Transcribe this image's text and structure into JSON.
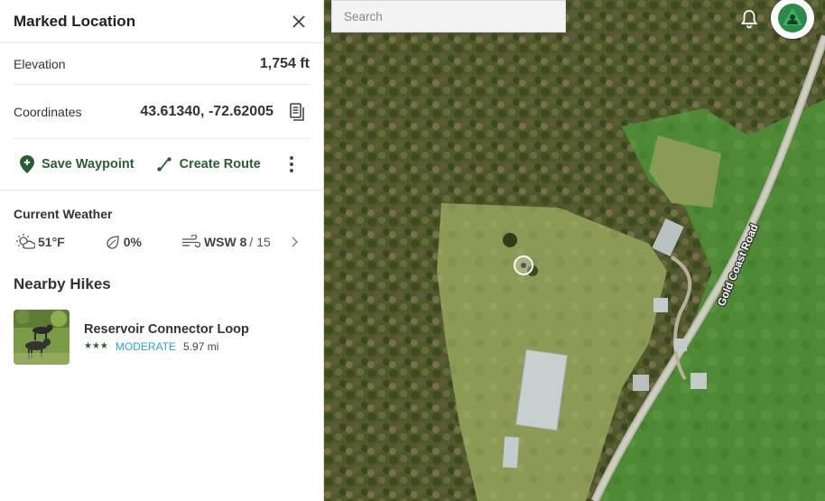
{
  "panel": {
    "title": "Marked Location",
    "elevation": {
      "label": "Elevation",
      "value": "1,754 ft"
    },
    "coordinates": {
      "label": "Coordinates",
      "value": "43.61340, -72.62005",
      "copy_icon": "copy-icon"
    },
    "actions": {
      "save_waypoint": "Save Waypoint",
      "create_route": "Create Route"
    },
    "weather": {
      "title": "Current Weather",
      "temperature": "51°F",
      "precipitation": "0%",
      "wind_dir_speed": "WSW 8",
      "wind_gust": "/ 15"
    },
    "nearby": {
      "title": "Nearby Hikes",
      "hikes": [
        {
          "name": "Reservoir Connector Loop",
          "stars": "★★★",
          "difficulty": "MODERATE",
          "distance": "5.97 mi"
        }
      ]
    }
  },
  "map": {
    "search_placeholder": "Search",
    "road_label": "Gold Coast Road"
  },
  "colors": {
    "brand_green": "#2b5d34",
    "difficulty_blue": "#2aa4c7"
  }
}
